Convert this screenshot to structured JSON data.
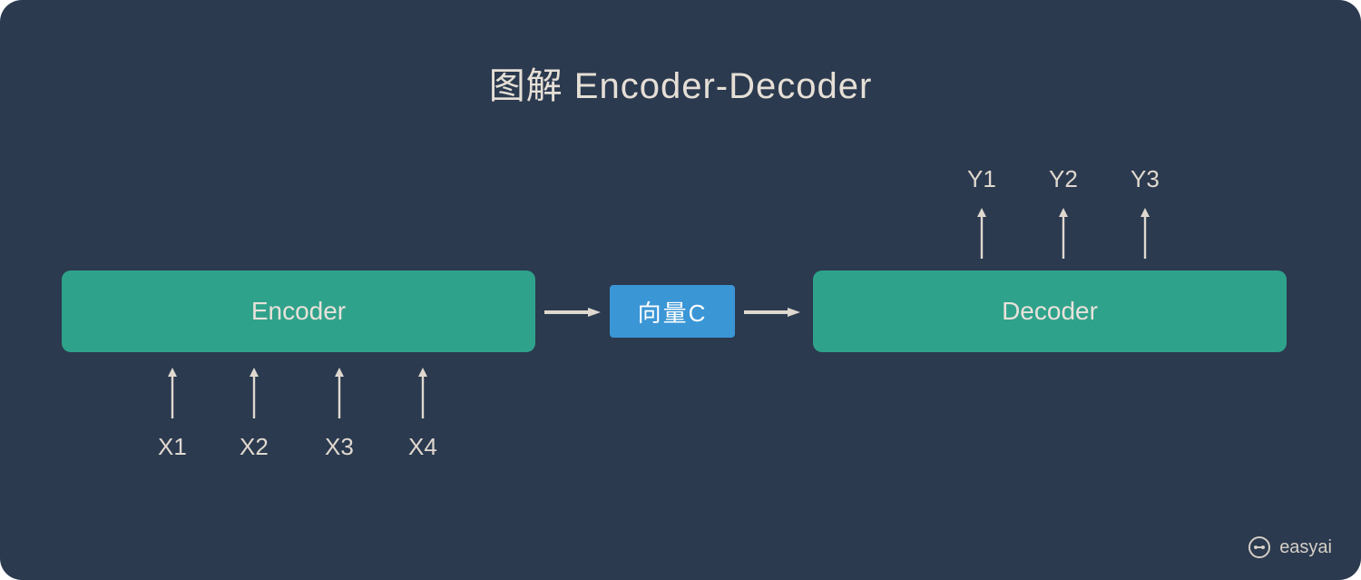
{
  "title": "图解 Encoder-Decoder",
  "encoder": {
    "label": "Encoder"
  },
  "vector": {
    "label": "向量C"
  },
  "decoder": {
    "label": "Decoder"
  },
  "inputs": [
    "X1",
    "X2",
    "X3",
    "X4"
  ],
  "outputs": [
    "Y1",
    "Y2",
    "Y3"
  ],
  "watermark": "easyai",
  "colors": {
    "background": "#2b3a4f",
    "box_encoder_decoder": "#2fa28b",
    "box_vector": "#3b96d6",
    "text": "#e0d8cf",
    "arrow": "#e0d8cf"
  }
}
